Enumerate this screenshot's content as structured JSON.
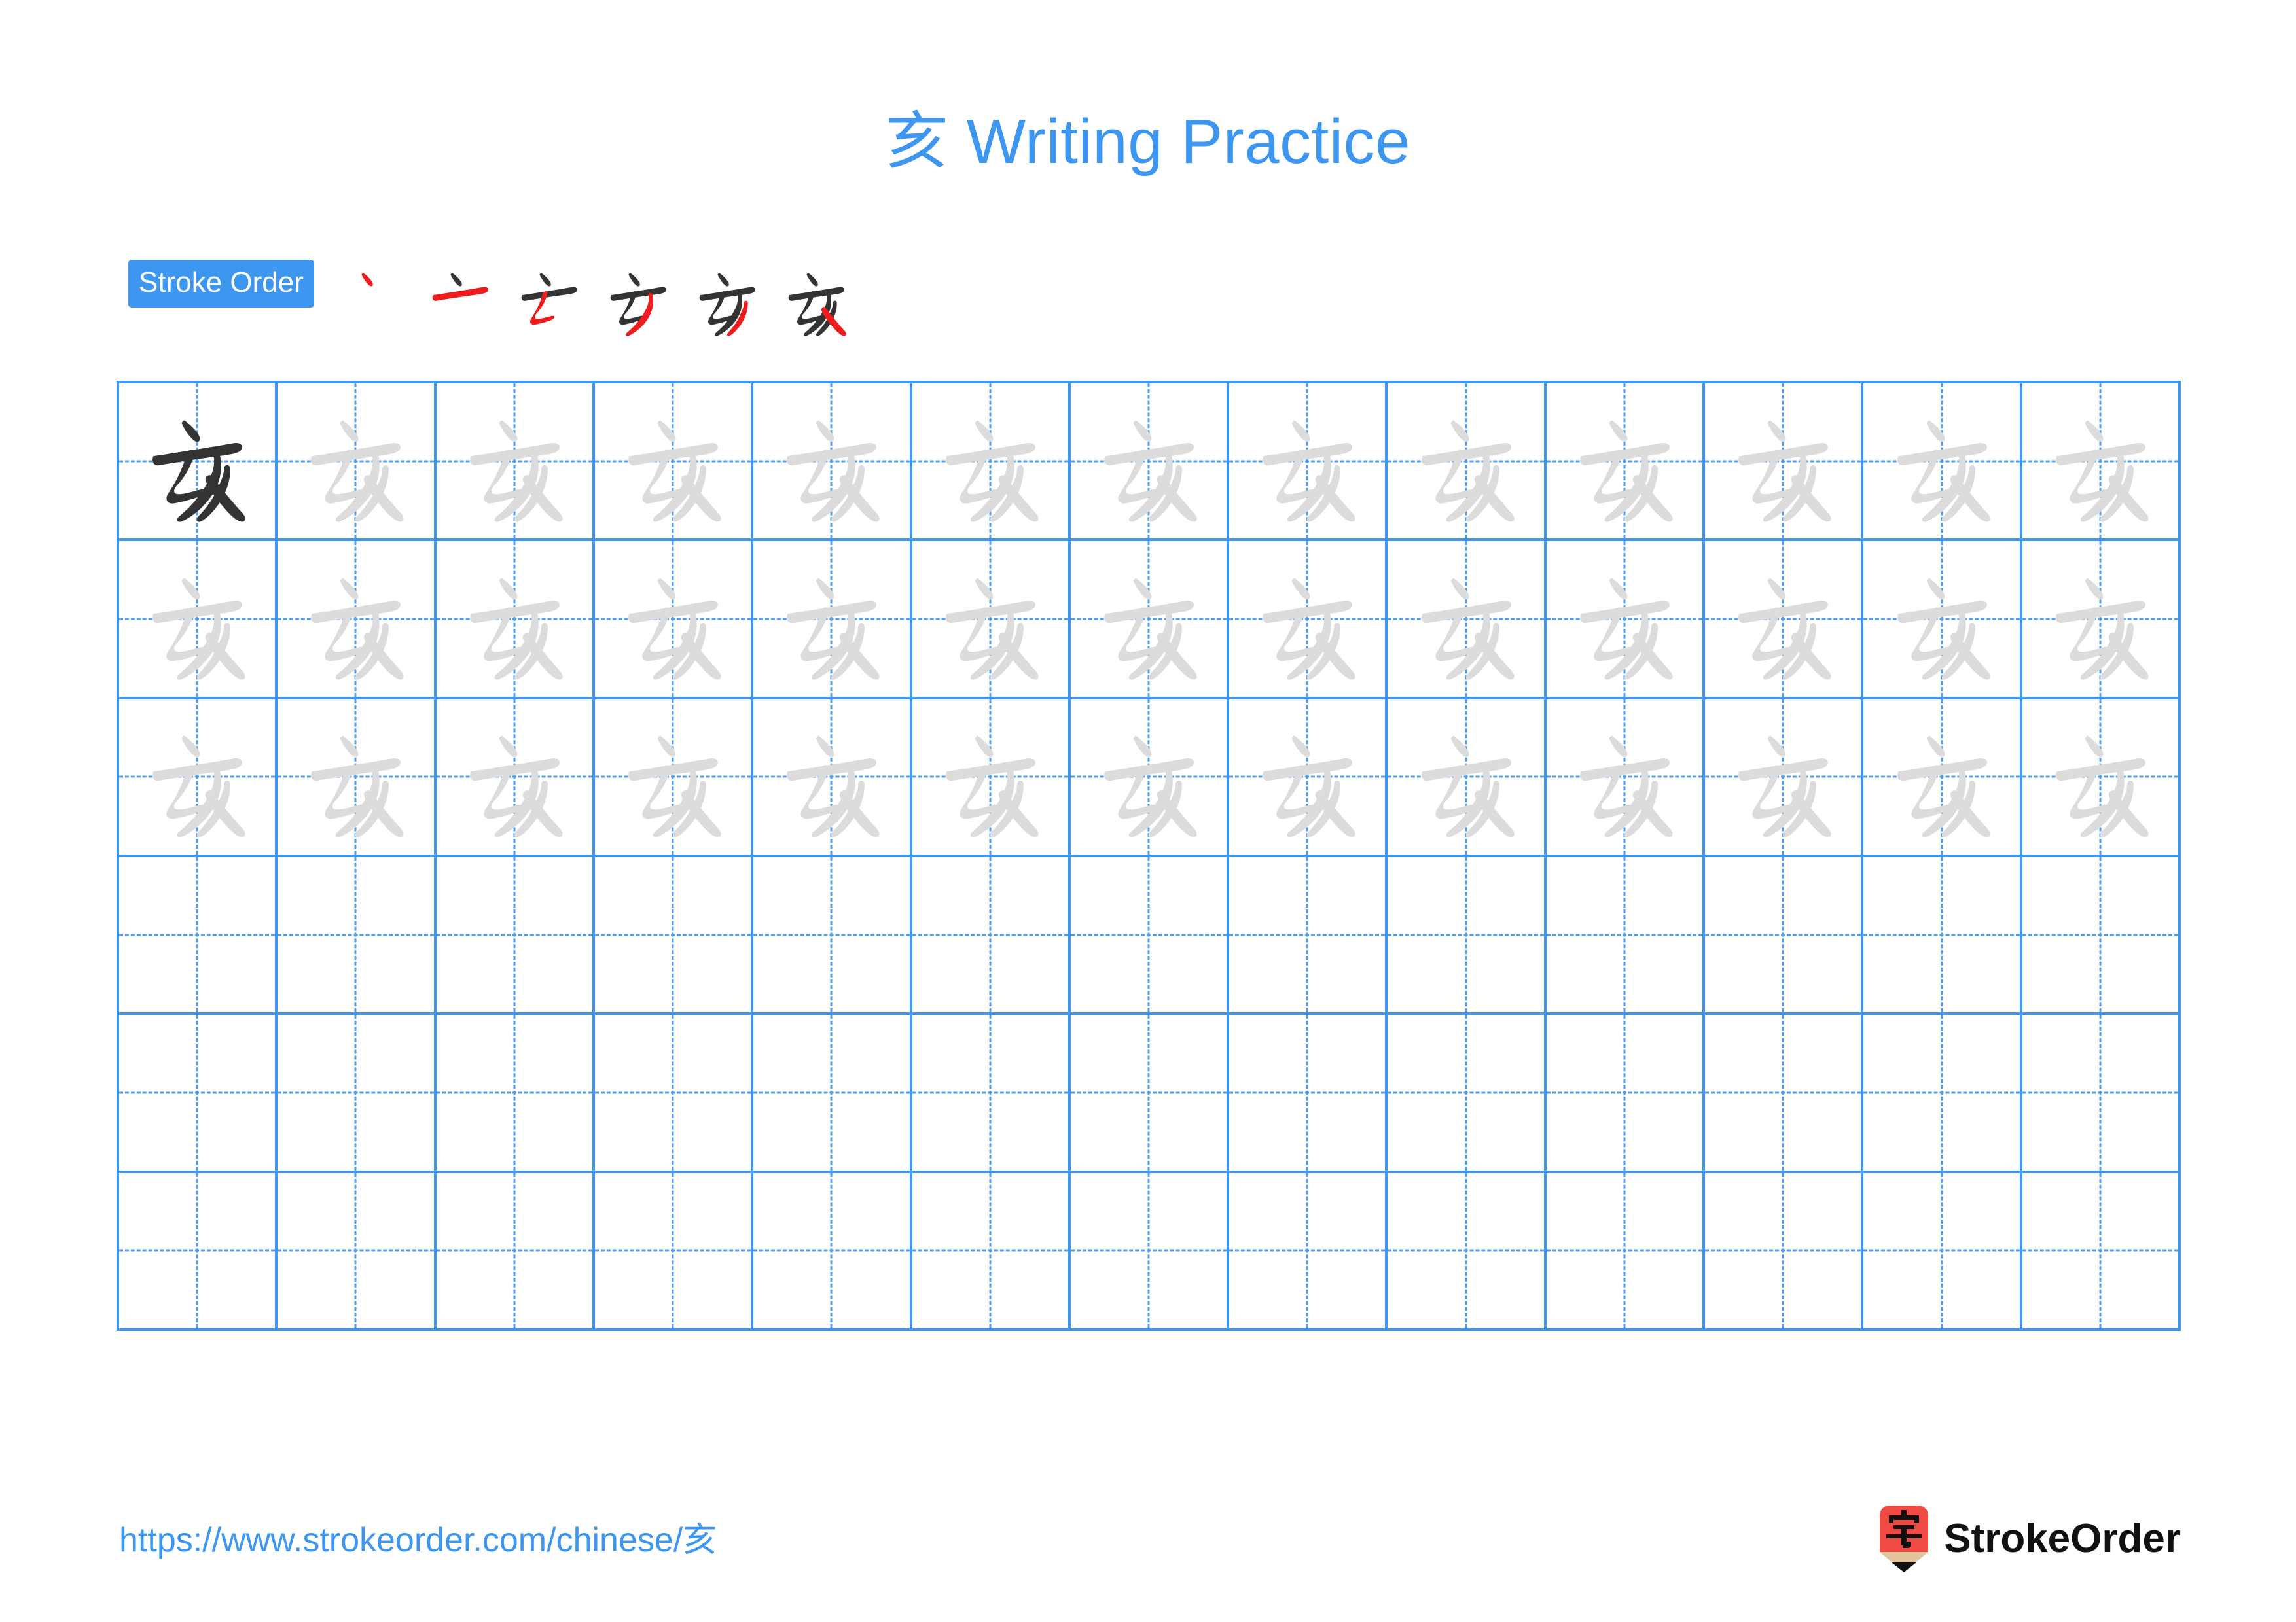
{
  "page": {
    "character": "亥",
    "title": "亥 Writing Practice",
    "title_char": "亥",
    "title_suffix": " Writing Practice",
    "background_color": "#ffffff",
    "accent_color": "#3d96f0",
    "highlight_stroke_color": "#ee1c1c",
    "dark_stroke_color": "#333333",
    "trace_stroke_color": "#dcdcdc"
  },
  "stroke_order": {
    "badge_label": "Stroke Order",
    "total_strokes": 6,
    "steps": [
      {
        "index": 1,
        "name": "stroke-step-1",
        "strokes_drawn": 1,
        "new_stroke": "dot"
      },
      {
        "index": 2,
        "name": "stroke-step-2",
        "strokes_drawn": 2,
        "new_stroke": "horizontal"
      },
      {
        "index": 3,
        "name": "stroke-step-3",
        "strokes_drawn": 3,
        "new_stroke": "left-falling-turn"
      },
      {
        "index": 4,
        "name": "stroke-step-4",
        "strokes_drawn": 4,
        "new_stroke": "long-left-falling"
      },
      {
        "index": 5,
        "name": "stroke-step-5",
        "strokes_drawn": 5,
        "new_stroke": "short-left-falling"
      },
      {
        "index": 6,
        "name": "stroke-step-6",
        "strokes_drawn": 6,
        "new_stroke": "right-falling"
      }
    ]
  },
  "practice_grid": {
    "columns": 13,
    "rows": 6,
    "cell_style": "tian-zi-ge",
    "grid_line_color": "#3d96f0",
    "guide_line_color": "#4f9ef2",
    "rows_data": [
      {
        "row": 1,
        "cells": [
          "solid",
          "trace",
          "trace",
          "trace",
          "trace",
          "trace",
          "trace",
          "trace",
          "trace",
          "trace",
          "trace",
          "trace",
          "trace"
        ]
      },
      {
        "row": 2,
        "cells": [
          "trace",
          "trace",
          "trace",
          "trace",
          "trace",
          "trace",
          "trace",
          "trace",
          "trace",
          "trace",
          "trace",
          "trace",
          "trace"
        ]
      },
      {
        "row": 3,
        "cells": [
          "trace",
          "trace",
          "trace",
          "trace",
          "trace",
          "trace",
          "trace",
          "trace",
          "trace",
          "trace",
          "trace",
          "trace",
          "trace"
        ]
      },
      {
        "row": 4,
        "cells": [
          "empty",
          "empty",
          "empty",
          "empty",
          "empty",
          "empty",
          "empty",
          "empty",
          "empty",
          "empty",
          "empty",
          "empty",
          "empty"
        ]
      },
      {
        "row": 5,
        "cells": [
          "empty",
          "empty",
          "empty",
          "empty",
          "empty",
          "empty",
          "empty",
          "empty",
          "empty",
          "empty",
          "empty",
          "empty",
          "empty"
        ]
      },
      {
        "row": 6,
        "cells": [
          "empty",
          "empty",
          "empty",
          "empty",
          "empty",
          "empty",
          "empty",
          "empty",
          "empty",
          "empty",
          "empty",
          "empty",
          "empty"
        ]
      }
    ]
  },
  "footer": {
    "url": "https://www.strokeorder.com/chinese/亥",
    "url_text": "https://www.strokeorder.com/chinese/",
    "url_char": "亥",
    "brand_name": "StrokeOrder",
    "brand_mark_char": "字",
    "brand_mark_body_color": "#ef4a43",
    "brand_mark_wood_color": "#e3c49b",
    "brand_mark_tip_color": "#111111"
  }
}
